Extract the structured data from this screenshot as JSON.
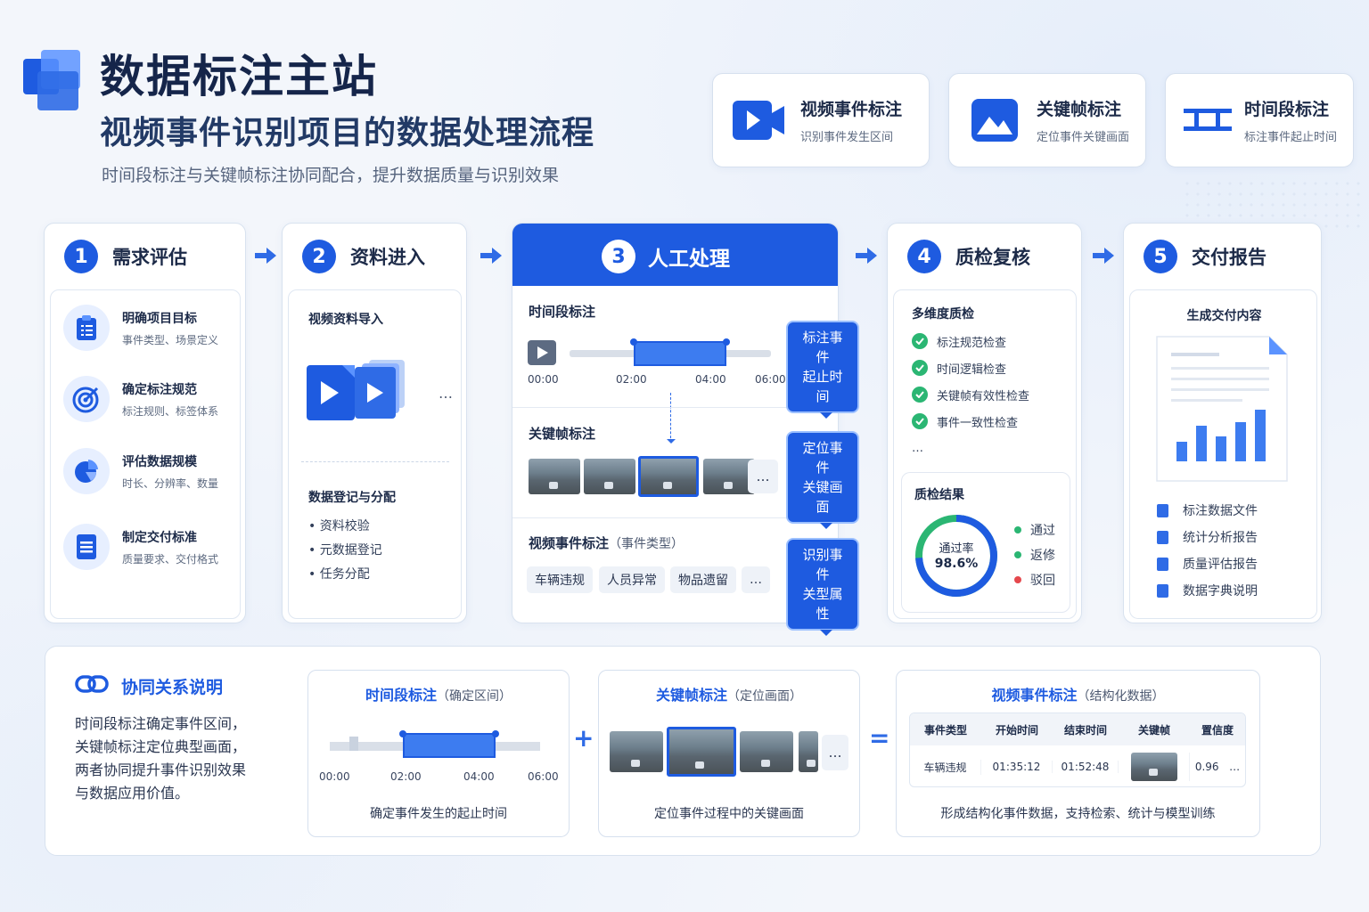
{
  "header": {
    "title": "数据标注主站",
    "subtitle": "视频事件识别项目的数据处理流程",
    "tagline": "时间段标注与关键帧标注协同配合，提升数据质量与识别效果"
  },
  "top_cards": [
    {
      "title": "视频事件标注",
      "desc": "识别事件发生区间",
      "icon": "video-camera-icon"
    },
    {
      "title": "关键帧标注",
      "desc": "定位事件关键画面",
      "icon": "image-icon"
    },
    {
      "title": "时间段标注",
      "desc": "标注事件起止时间",
      "icon": "timeline-range-icon"
    }
  ],
  "stages": [
    {
      "num": "1",
      "label": "需求评估",
      "items": [
        {
          "title": "明确项目目标",
          "desc": "事件类型、场景定义",
          "icon": "clipboard-icon"
        },
        {
          "title": "确定标注规范",
          "desc": "标注规则、标签体系",
          "icon": "target-icon"
        },
        {
          "title": "评估数据规模",
          "desc": "时长、分辨率、数量",
          "icon": "pie-chart-icon"
        },
        {
          "title": "制定交付标准",
          "desc": "质量要求、交付格式",
          "icon": "document-icon"
        }
      ]
    },
    {
      "num": "2",
      "label": "资料进入",
      "section1": "视频资料导入",
      "more": "…",
      "section2": "数据登记与分配",
      "bullets": [
        "资料校验",
        "元数据登记",
        "任务分配"
      ]
    },
    {
      "num": "3",
      "label": "人工处理",
      "time_section": "时间段标注",
      "ticks": [
        "00:00",
        "02:00",
        "04:00",
        "06:00"
      ],
      "callout1": "标注事件\n起止时间",
      "key_section": "关键帧标注",
      "callout2": "定位事件\n关键画面",
      "event_section": "视频事件标注",
      "event_section_note": "（事件类型）",
      "event_tags": [
        "车辆违规",
        "人员异常",
        "物品遗留"
      ],
      "callout3": "识别事件\n关型属性",
      "more": "…"
    },
    {
      "num": "4",
      "label": "质检复核",
      "qc_title": "多维度质检",
      "qc_items": [
        "标注规范检查",
        "时间逻辑检查",
        "关键帧有效性检查",
        "事件一致性检查"
      ],
      "more": "…",
      "result_title": "质检结果",
      "pass_label": "通过率",
      "pass_value": "98.6%",
      "pass_fraction": 0.986,
      "legend": [
        {
          "label": "通过",
          "color": "#2bb673"
        },
        {
          "label": "返修",
          "color": "#2bb673"
        },
        {
          "label": "驳回",
          "color": "#e5484d"
        }
      ]
    },
    {
      "num": "5",
      "label": "交付报告",
      "content_title": "生成交付内容",
      "docs": [
        "标注数据文件",
        "统计分析报告",
        "质量评估报告",
        "数据字典说明"
      ]
    }
  ],
  "bottom": {
    "title": "协同关系说明",
    "desc_lines": [
      "时间段标注确定事件区间，",
      "关键帧标注定位典型画面，",
      "两者协同提升事件识别效果",
      "与数据应用价值。"
    ],
    "card1": {
      "title": "时间段标注",
      "note": "（确定区间）",
      "ticks": [
        "00:00",
        "02:00",
        "04:00",
        "06:00"
      ],
      "caption": "确定事件发生的起止时间"
    },
    "card2": {
      "title": "关键帧标注",
      "note": "（定位画面）",
      "caption": "定位事件过程中的关键画面"
    },
    "card3": {
      "title": "视频事件标注",
      "note": "（结构化数据）",
      "columns": [
        "事件类型",
        "开始时间",
        "结束时间",
        "关键帧",
        "置信度"
      ],
      "row": [
        "车辆违规",
        "01:35:12",
        "01:52:48",
        "",
        "0.96"
      ],
      "caption": "形成结构化事件数据，支持检索、统计与模型训练"
    },
    "op_plus": "+",
    "op_equals": "=",
    "more": "…"
  },
  "colors": {
    "accent": "#1e5be0",
    "pass": "#2bb673",
    "reject": "#e5484d"
  }
}
